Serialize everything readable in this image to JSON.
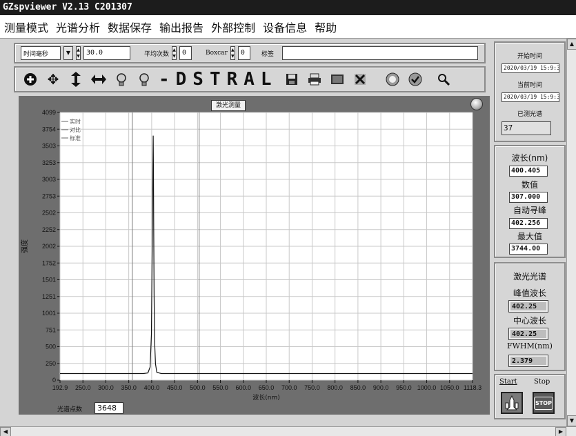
{
  "window": {
    "title": "GZspviewer V2.13 C201307"
  },
  "menu": [
    "测量模式",
    "光谱分析",
    "数据保存",
    "输出报告",
    "外部控制",
    "设备信息",
    "帮助"
  ],
  "controls": {
    "mode_select": "时间毫秒",
    "integration_time": "30.0",
    "avg_label": "平均次数",
    "avg_value": "0",
    "boxcar_label": "Boxcar",
    "boxcar_value": "0",
    "tag_label": "标签",
    "tag_value": ""
  },
  "toolbar": {
    "text": "-DSTRAL",
    "icons": [
      "plus-circle-icon",
      "move-icon",
      "vertical-zoom-icon",
      "horizontal-zoom-icon",
      "cursor-a-icon",
      "cursor-b-icon",
      "save-icon",
      "print-icon",
      "image-icon",
      "close-icon",
      "info-icon",
      "check-icon",
      "magnify-icon"
    ]
  },
  "plot": {
    "title_label": "激光测量",
    "legend": [
      "实时",
      "对比",
      "标准"
    ],
    "ylabel": "强度",
    "xlabel": "波长(nm)",
    "points_label": "光谱点数",
    "points_value": "3648"
  },
  "chart_data": {
    "type": "line",
    "xlabel": "波长(nm)",
    "ylabel": "强度",
    "xlim": [
      192.9,
      1118.3
    ],
    "ylim": [
      0,
      4099
    ],
    "y_ticks": [
      "4099",
      "3754",
      "3503",
      "3253",
      "3003",
      "2753",
      "2502",
      "2252",
      "2002",
      "1752",
      "1501",
      "1251",
      "1001",
      "751",
      "500",
      "250",
      "0"
    ],
    "x_ticks": [
      "192.9",
      "250.0",
      "300.0",
      "350.0",
      "400.0",
      "450.0",
      "500.0",
      "550.0",
      "600.0",
      "650.0",
      "700.0",
      "750.0",
      "800.0",
      "850.0",
      "900.0",
      "950.0",
      "1000.0",
      "1050.0",
      "1118.3"
    ],
    "cursors": [
      {
        "x": 355
      },
      {
        "x": 505
      }
    ],
    "series": [
      {
        "x": [
          192.9,
          300,
          380,
          390,
          395,
          398,
          400,
          401,
          402,
          402.5,
          403,
          404,
          405,
          407,
          410,
          420,
          500,
          700,
          900,
          1118.3
        ],
        "y": [
          100,
          100,
          100,
          110,
          200,
          700,
          2200,
          3100,
          3744,
          3300,
          2400,
          1300,
          600,
          250,
          120,
          100,
          100,
          100,
          100,
          100
        ]
      }
    ]
  },
  "right_panel": {
    "start_time_label": "开始时间",
    "start_time": "2020/03/19 15:9:3:",
    "current_time_label": "当前时间",
    "current_time": "2020/03/19 15:9:3(",
    "measured_label": "已测光谱",
    "measured_value": "37",
    "wavelength_label": "波长(nm)",
    "wavelength_value": "400.405",
    "value_label": "数值",
    "value_value": "307.000",
    "autopeak_label": "自动寻峰",
    "autopeak_value": "402.256",
    "max_label": "最大值",
    "max_value": "3744.00",
    "laser_label": "激光光谱",
    "peak_wl_label": "峰值波长",
    "peak_wl_value": "402.25",
    "center_wl_label": "中心波长",
    "center_wl_value": "402.25",
    "fwhm_label": "FWHM(nm)",
    "fwhm_value": "2.379",
    "start_label": "Start",
    "stop_label": "Stop",
    "stop_icon_text": "STOP"
  }
}
